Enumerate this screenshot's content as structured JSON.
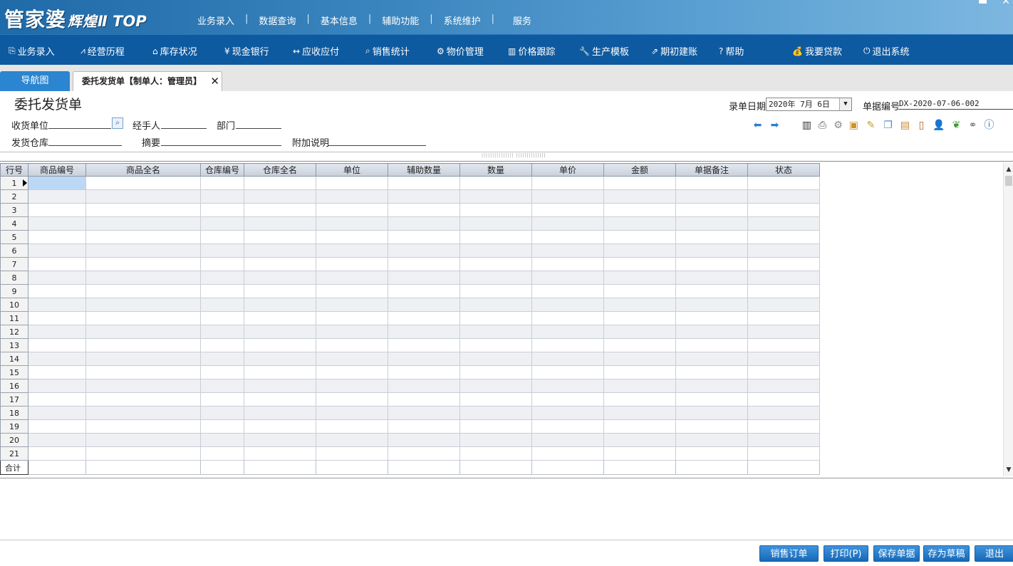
{
  "app": {
    "logo_main": "管家婆",
    "logo_sub": "辉煌",
    "logo_edition": "Ⅱ TOP",
    "top_menu": [
      "业务录入",
      "数据查询",
      "基本信息",
      "辅助功能",
      "系统维护",
      "服务"
    ],
    "top_menu_separator": "|"
  },
  "nav": {
    "items": [
      {
        "icon": "document-icon",
        "glyph": "⎘",
        "label": "业务录入"
      },
      {
        "icon": "line-chart-icon",
        "glyph": "⩘",
        "label": "经营历程"
      },
      {
        "icon": "home-icon",
        "glyph": "⌂",
        "label": "库存状况"
      },
      {
        "icon": "yen-icon",
        "glyph": "¥",
        "label": "现金银行"
      },
      {
        "icon": "exchange-icon",
        "glyph": "↔",
        "label": "应收应付"
      },
      {
        "icon": "search-icon",
        "glyph": "⌕",
        "label": "销售统计"
      },
      {
        "icon": "gear-icon",
        "glyph": "⚙",
        "label": "物价管理"
      },
      {
        "icon": "bar-chart-icon",
        "glyph": "▥",
        "label": "价格跟踪"
      },
      {
        "icon": "wrench-icon",
        "glyph": "🔧",
        "label": "生产模板"
      },
      {
        "icon": "external-link-icon",
        "glyph": "⇗",
        "label": "期初建账"
      },
      {
        "icon": "question-icon",
        "glyph": "?",
        "label": "帮助"
      },
      {
        "icon": "money-bag-icon",
        "glyph": "💰",
        "label": "我要贷款"
      },
      {
        "icon": "power-icon",
        "glyph": "⏻",
        "label": "退出系统"
      }
    ]
  },
  "tabs": {
    "nav_tab": "导航图",
    "current_tab": "委托发货单【制单人：管理员】",
    "close_glyph": "✕"
  },
  "form": {
    "title": "委托发货单",
    "receiver_label": "收货单位",
    "handler_label": "经手人",
    "department_label": "部门",
    "warehouse_label": "发货仓库",
    "summary_label": "摘要",
    "note_label": "附加说明",
    "date_label": "录单日期",
    "date_value": "2020年 7月 6日",
    "bill_no_label": "单据编号",
    "bill_no_value": "DX-2020-07-06-002"
  },
  "grid": {
    "columns": [
      "行号",
      "商品编号",
      "商品全名",
      "仓库编号",
      "仓库全名",
      "单位",
      "辅助数量",
      "数量",
      "单价",
      "金额",
      "单据备注",
      "状态"
    ],
    "row_count": 21,
    "rows": [
      "1",
      "2",
      "3",
      "4",
      "5",
      "6",
      "7",
      "8",
      "9",
      "10",
      "11",
      "12",
      "13",
      "14",
      "15",
      "16",
      "17",
      "18",
      "19",
      "20",
      "21"
    ],
    "total_label": "合计"
  },
  "buttons": {
    "sales_order": "销售订单",
    "print": "打印(P)",
    "save": "保存单据",
    "draft": "存为草稿",
    "exit": "退出"
  },
  "colors": {
    "banner": "#3c86c0",
    "nav_bg": "#0e5aa0",
    "accent": "#2b85d0",
    "selected_cell": "#bcd8f5"
  }
}
